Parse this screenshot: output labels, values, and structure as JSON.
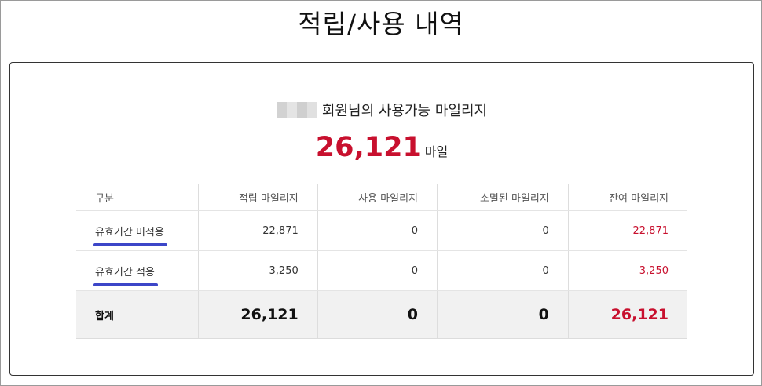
{
  "page": {
    "title": "적립/사용 내역"
  },
  "summary": {
    "member_suffix": "회원님의 사용가능 마일리지",
    "available_amount": "26,121",
    "unit": "마일"
  },
  "table": {
    "headers": [
      "구분",
      "적립 마일리지",
      "사용 마일리지",
      "소멸된 마일리지",
      "잔여 마일리지"
    ],
    "rows": [
      {
        "label": "유효기간 미적용",
        "earned": "22,871",
        "used": "0",
        "expired": "0",
        "remaining": "22,871"
      },
      {
        "label": "유효기간 적용",
        "earned": "3,250",
        "used": "0",
        "expired": "0",
        "remaining": "3,250"
      }
    ],
    "total": {
      "label": "합계",
      "earned": "26,121",
      "used": "0",
      "expired": "0",
      "remaining": "26,121"
    }
  },
  "colors": {
    "accent_red": "#c8102e",
    "underline_blue": "#3c46c8"
  }
}
